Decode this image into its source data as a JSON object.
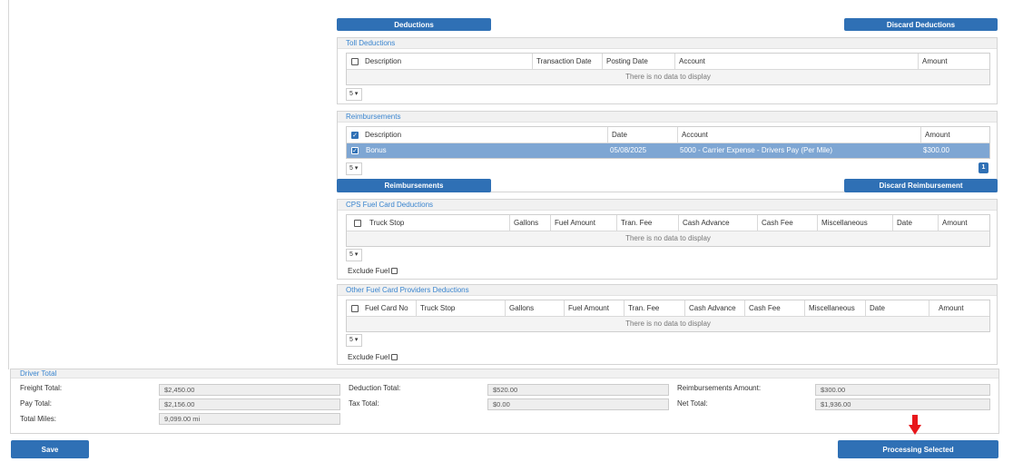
{
  "top_buttons": {
    "deductions": "Deductions",
    "discard_deductions": "Discard Deductions"
  },
  "toll": {
    "title": "Toll Deductions",
    "columns": [
      "Description",
      "Transaction Date",
      "Posting Date",
      "Account",
      "Amount"
    ],
    "empty_text": "There is no data to display",
    "page_size": "5"
  },
  "reimbursements": {
    "title": "Reimbursements",
    "columns": [
      "Description",
      "Date",
      "Account",
      "Amount"
    ],
    "row": {
      "description": "Bonus",
      "date": "05/08/2025",
      "account": "5000 - Carrier Expense - Drivers Pay (Per Mile)",
      "amount": "$300.00"
    },
    "page_size": "5",
    "page_number": "1",
    "button": "Reimbursements",
    "discard_button": "Discard Reimbursement"
  },
  "cps": {
    "title": "CPS Fuel Card Deductions",
    "columns": [
      "Truck Stop",
      "Gallons",
      "Fuel Amount",
      "Tran. Fee",
      "Cash Advance",
      "Cash Fee",
      "Miscellaneous",
      "Date",
      "Amount"
    ],
    "empty_text": "There is no data to display",
    "page_size": "5",
    "exclude_fuel": "Exclude Fuel"
  },
  "other": {
    "title": "Other Fuel Card Providers Deductions",
    "columns": [
      "Fuel Card No",
      "Truck Stop",
      "Gallons",
      "Fuel Amount",
      "Tran. Fee",
      "Cash Advance",
      "Cash Fee",
      "Miscellaneous",
      "Date",
      "Amount"
    ],
    "empty_text": "There is no data to display",
    "page_size": "5",
    "exclude_fuel": "Exclude Fuel"
  },
  "driver_total": {
    "title": "Driver Total",
    "freight_label": "Freight Total:",
    "freight_value": "$2,450.00",
    "pay_label": "Pay Total:",
    "pay_value": "$2,156.00",
    "miles_label": "Total Miles:",
    "miles_value": "9,099.00 mi",
    "deduction_label": "Deduction Total:",
    "deduction_value": "$520.00",
    "tax_label": "Tax Total:",
    "tax_value": "$0.00",
    "reimb_label": "Reimbursements Amount:",
    "reimb_value": "$300.00",
    "net_label": "Net Total:",
    "net_value": "$1,936.00"
  },
  "footer": {
    "save": "Save",
    "processing": "Processing Selected"
  },
  "colors": {
    "accent": "#2f70b5",
    "selected_row": "#7ea6d3",
    "section_title": "#3a85cf",
    "arrow": "#e8161b"
  }
}
